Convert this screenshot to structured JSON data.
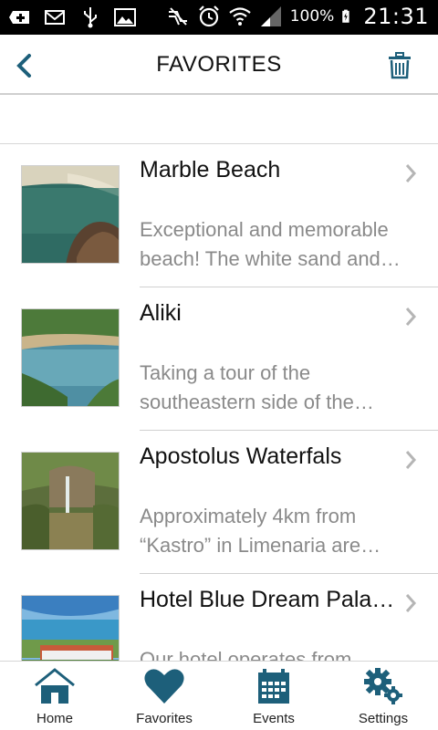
{
  "status_bar": {
    "battery": "100%",
    "time": "21:31"
  },
  "header": {
    "title": "FAVORITES"
  },
  "favorites": [
    {
      "title": "Marble Beach",
      "description": "Exceptional and memorable beach! The white sand and…"
    },
    {
      "title": "Aliki",
      "description": "Taking a tour of the southeastern side of the…"
    },
    {
      "title": "Apostolus Waterfals",
      "description": "Approximately 4km from “Kastro” in Limenaria are…"
    },
    {
      "title": "Hotel Blue Dream Pala…",
      "description": "Our hotel operates from mid…"
    }
  ],
  "bottom_nav": {
    "home": "Home",
    "favorites": "Favorites",
    "events": "Events",
    "settings": "Settings"
  },
  "colors": {
    "accent": "#1d5f7a",
    "status_bar": "#000000",
    "muted_text": "#8a8a8a"
  }
}
